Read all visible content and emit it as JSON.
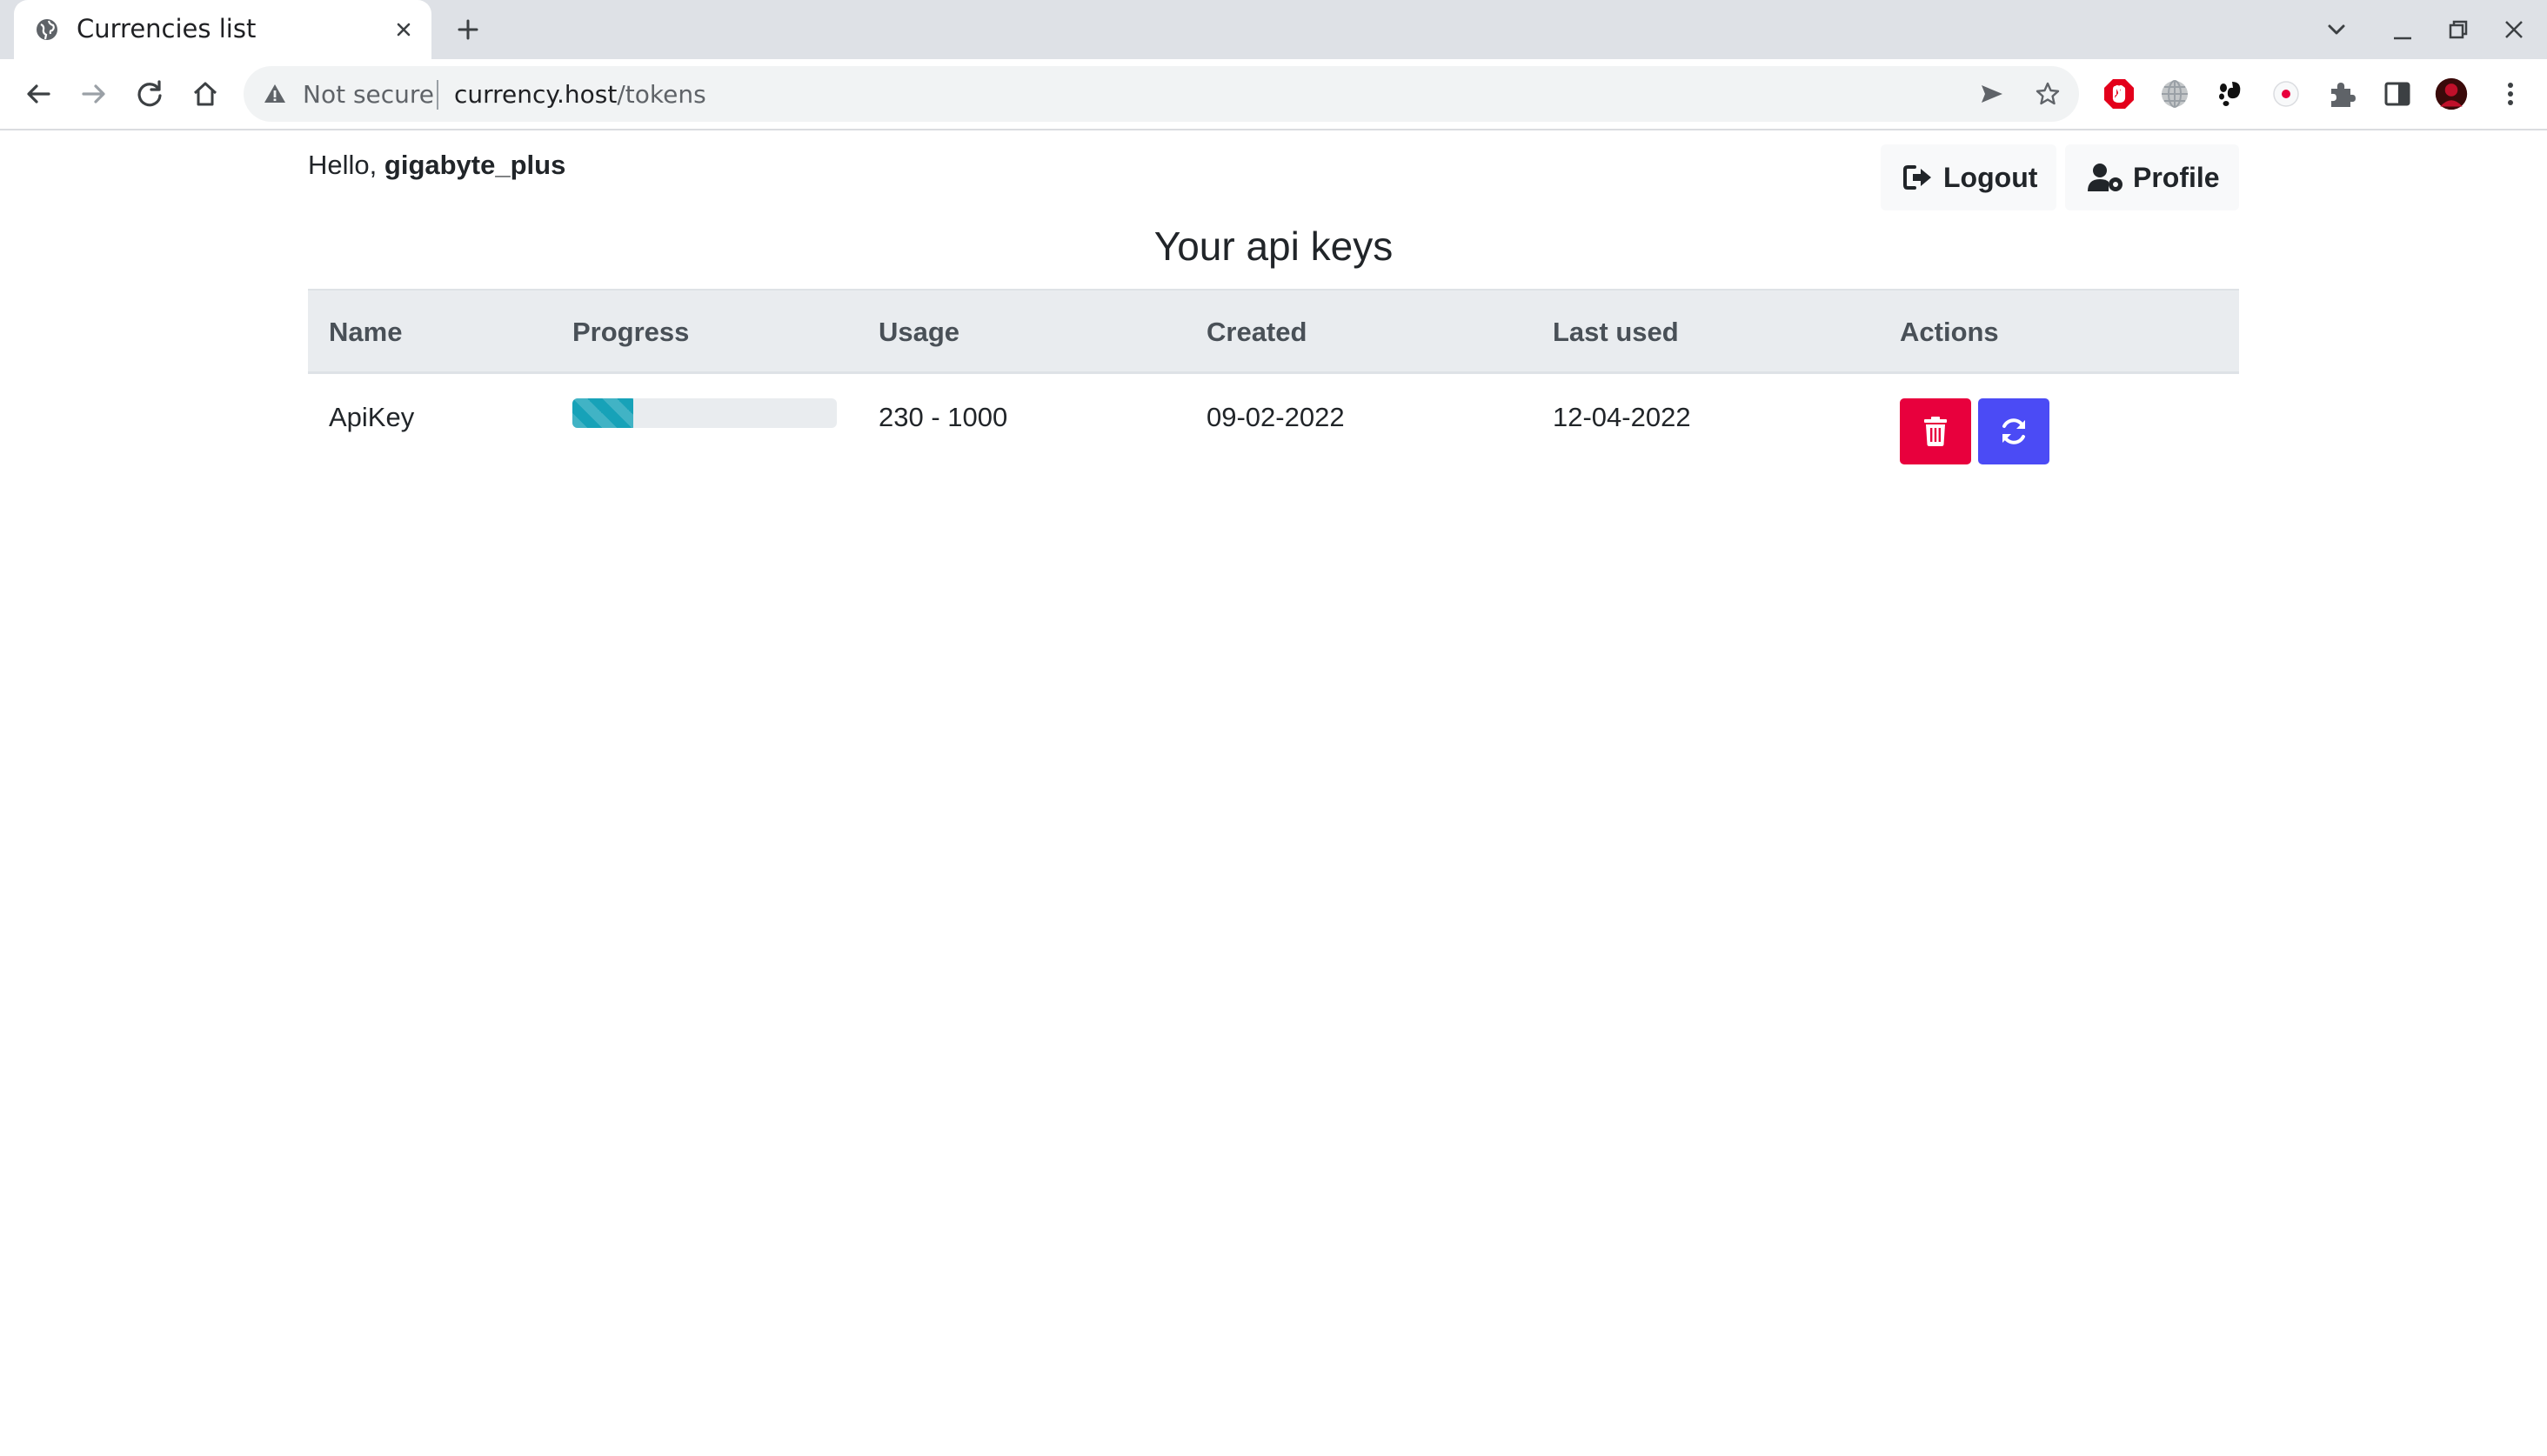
{
  "browser": {
    "tab_title": "Currencies list",
    "security_label": "Not secure",
    "url_host": "currency.host",
    "url_path": "/tokens"
  },
  "header": {
    "greeting": "Hello,",
    "username": "gigabyte_plus",
    "logout_label": "Logout",
    "profile_label": "Profile"
  },
  "main": {
    "title": "Your api keys",
    "columns": [
      "Name",
      "Progress",
      "Usage",
      "Created",
      "Last used",
      "Actions"
    ],
    "rows": [
      {
        "name": "ApiKey",
        "progress": 0.23,
        "usage": "230 - 1000",
        "created": "09-02-2022",
        "last_used": "12-04-2022"
      }
    ]
  },
  "colors": {
    "delete_button": "#e8003d",
    "refresh_button": "#4b4bf5",
    "progress_bar": "#17a2b8"
  },
  "icons": {
    "logout": "sign-out-icon",
    "profile": "user-cog-icon",
    "delete": "trash-icon",
    "refresh": "sync-icon"
  }
}
